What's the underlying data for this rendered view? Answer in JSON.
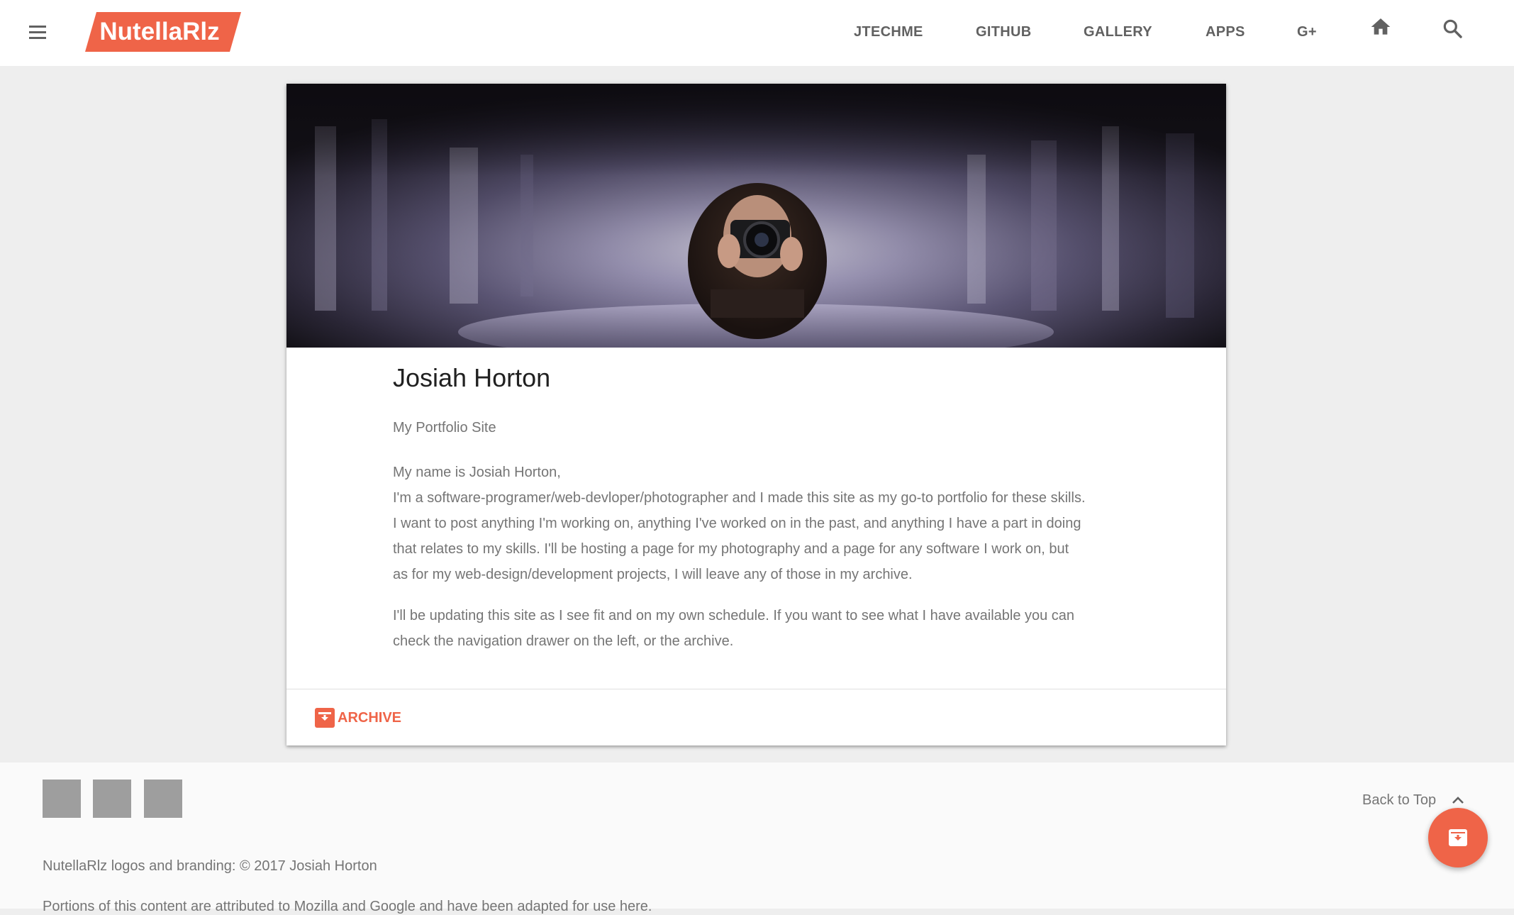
{
  "header": {
    "logo_text": "NutellaRlz",
    "nav": [
      {
        "label": "JTECHME"
      },
      {
        "label": "GITHUB"
      },
      {
        "label": "GALLERY"
      },
      {
        "label": "APPS"
      },
      {
        "label": "G+"
      }
    ],
    "icons": [
      "menu-icon",
      "home-icon",
      "search-icon"
    ]
  },
  "card": {
    "hero_image": "blurred-photographer-with-camera",
    "title": "Josiah Horton",
    "subtitle": "My Portfolio Site",
    "paragraph1": [
      "My name is Josiah Horton,",
      "I'm a software-programer/web-devloper/photographer and I made this site as my go-to portfolio for these skills.",
      "I want to post anything I'm working on, anything I've worked on in the past, and anything I have a part in doing",
      "that relates to my skills. I'll be hosting a page for my photography and a page for any software I work on, but",
      "as for my web-design/development projects, I will leave any of those in my archive."
    ],
    "paragraph2": [
      "I'll be updating this site as I see fit and on my own schedule. If you want to see what I have available you can",
      "check the navigation drawer on the left, or the archive."
    ],
    "action_label": "ARCHIVE"
  },
  "footer": {
    "copyright": "NutellaRlz logos and branding: © 2017 Josiah Horton",
    "attribution": "Portions of this content are attributed to Mozilla and Google and have been adapted for use here.",
    "back_to_top": "Back to Top"
  },
  "colors": {
    "accent": "#ef6448",
    "header_bg": "#ffffff",
    "page_bg": "#eeeeee",
    "footer_bg": "#fafafa",
    "social_placeholder": "#9e9e9e"
  }
}
